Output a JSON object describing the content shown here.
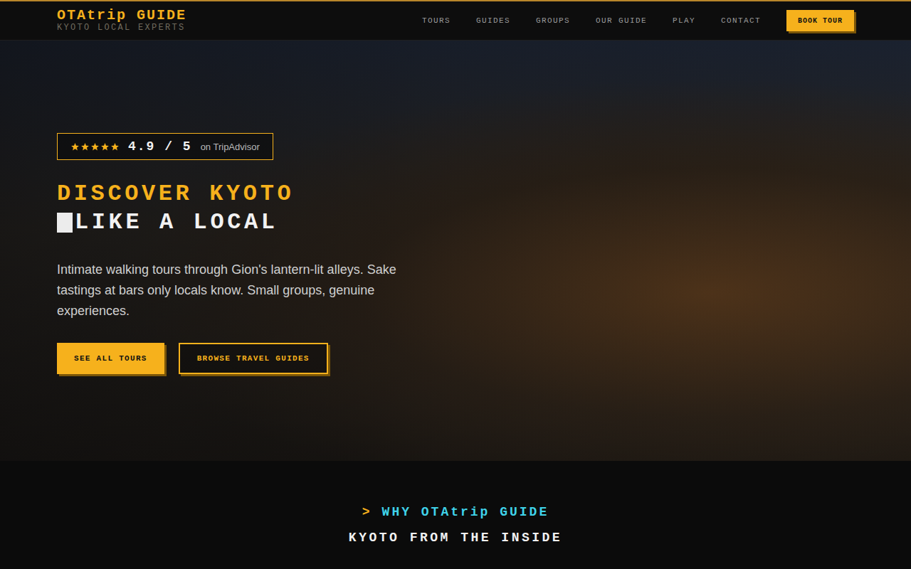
{
  "header": {
    "logo": "OTAtrip GUIDE",
    "subtitle": "KYOTO LOCAL EXPERTS",
    "nav": [
      {
        "label": "TOURS",
        "selected": false
      },
      {
        "label": "GUIDES",
        "selected": false
      },
      {
        "label": "GROUPS",
        "selected": false
      },
      {
        "label": "OUR GUIDE",
        "selected": false
      },
      {
        "label": "PLAY",
        "selected": false
      },
      {
        "label": "CONTACT",
        "selected": false
      }
    ],
    "cta": "BOOK TOUR"
  },
  "hero": {
    "rating": {
      "stars": 5,
      "score": "4.9 / 5",
      "source": "on TripAdvisor"
    },
    "title_lines": [
      {
        "text": "DISCOVER KYOTO",
        "cursor": false
      },
      {
        "text": "LIKE A LOCAL",
        "cursor": true
      }
    ],
    "description": "Intimate walking tours through Gion's lantern-lit alleys. Sake tastings at bars only locals know. Small groups, genuine experiences.",
    "buttons": [
      {
        "label": "SEE ALL TOURS",
        "kind": "primary"
      },
      {
        "label": "BROWSE TRAVEL GUIDES",
        "kind": "outline"
      }
    ]
  },
  "section": {
    "marker": ">",
    "eyebrow": "WHY OTAtrip GUIDE",
    "title": "KYOTO FROM THE INSIDE"
  }
}
